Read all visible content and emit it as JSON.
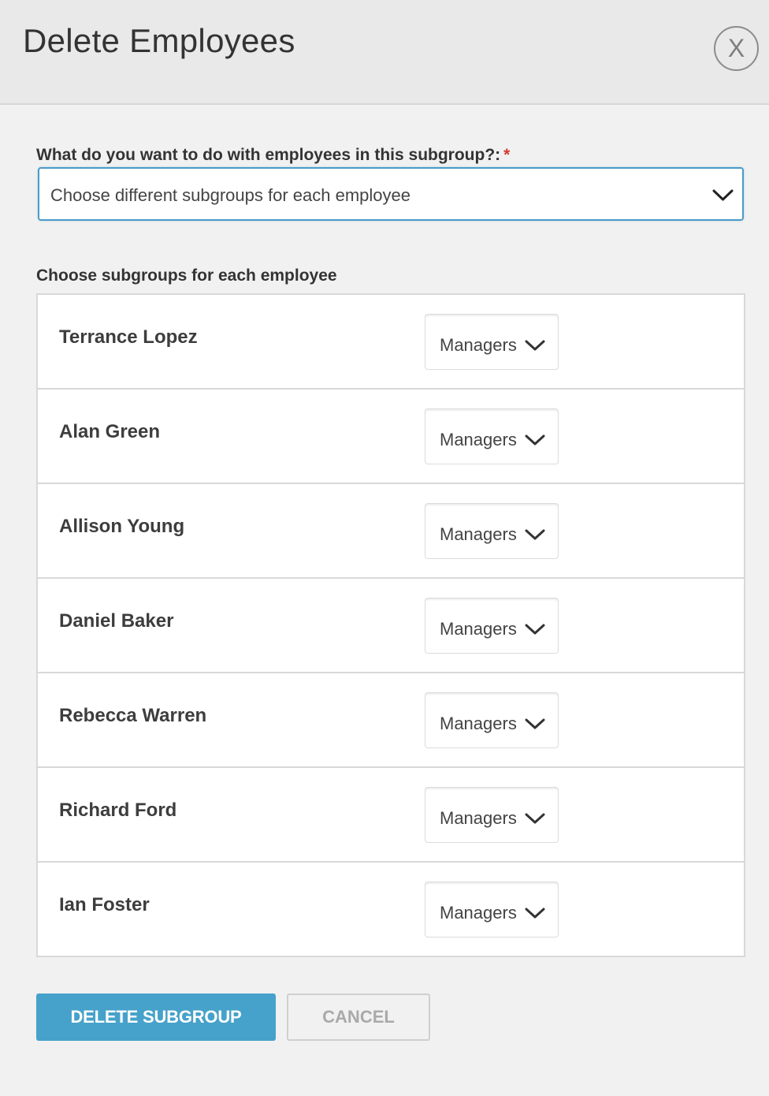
{
  "dialog": {
    "title": "Delete Employees",
    "close_label": "X"
  },
  "action_field": {
    "label": "What do you want to do with employees in this subgroup?:",
    "required_marker": "*",
    "selected_value": "Choose different subgroups for each employee",
    "chevron_icon": "chevron-down-icon"
  },
  "employees_section": {
    "label": "Choose subgroups for each employee",
    "rows": [
      {
        "name": "Terrance Lopez",
        "subgroup": "Managers"
      },
      {
        "name": "Alan Green",
        "subgroup": "Managers"
      },
      {
        "name": "Allison Young",
        "subgroup": "Managers"
      },
      {
        "name": "Daniel Baker",
        "subgroup": "Managers"
      },
      {
        "name": "Rebecca Warren",
        "subgroup": "Managers"
      },
      {
        "name": "Richard Ford",
        "subgroup": "Managers"
      },
      {
        "name": "Ian Foster",
        "subgroup": "Managers"
      }
    ]
  },
  "buttons": {
    "delete_label": "DELETE SUBGROUP",
    "cancel_label": "CANCEL"
  },
  "colors": {
    "primary": "#46a2ca",
    "focus_border": "#4a9cc7",
    "required": "#d33a2c",
    "header_bg": "#e9e9e9",
    "page_bg": "#f1f1f1"
  }
}
